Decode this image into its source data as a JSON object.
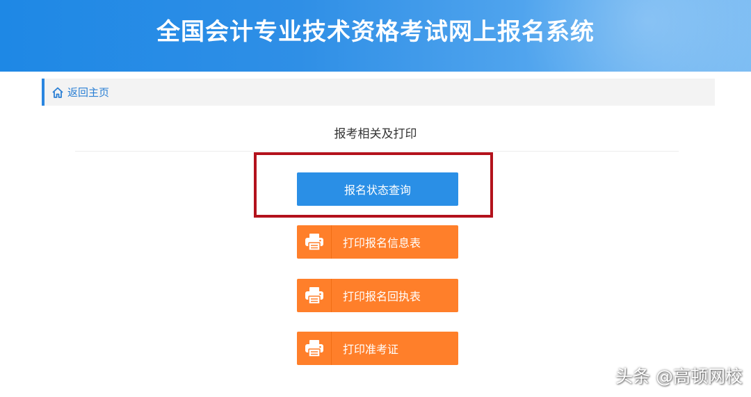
{
  "header": {
    "title": "全国会计专业技术资格考试网上报名系统"
  },
  "breadcrumb": {
    "icon": "home-icon",
    "label": "返回主页"
  },
  "section": {
    "title": "报考相关及打印"
  },
  "buttons": {
    "status_query": "报名状态查询",
    "print_info": "打印报名信息表",
    "print_receipt": "打印报名回执表",
    "print_admission": "打印准考证"
  },
  "watermark": {
    "text": "头条 @高顿网校"
  },
  "colors": {
    "banner_blue": "#1e88e5",
    "button_blue": "#2a8fe6",
    "button_orange": "#ff7f2a",
    "highlight_red": "#b3121c"
  }
}
